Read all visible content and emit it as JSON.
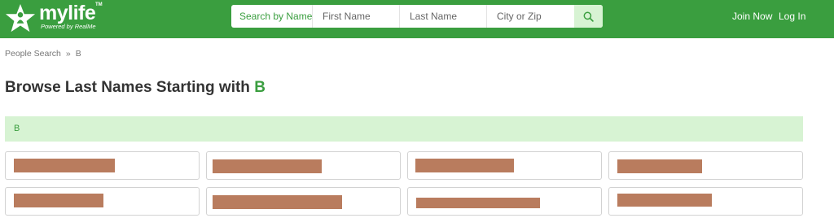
{
  "brand": {
    "name": "mylife",
    "trademark": "TM",
    "tagline": "Powered by RealMe",
    "color": "#3a9e3f"
  },
  "search": {
    "mode_label": "Search by Name",
    "first_placeholder": "First Name",
    "last_placeholder": "Last Name",
    "city_placeholder": "City or Zip",
    "button_icon": "search-icon"
  },
  "nav": {
    "join": "Join Now",
    "login": "Log In"
  },
  "breadcrumb": {
    "root": "People Search",
    "separator": "»",
    "current": "B"
  },
  "page": {
    "title_prefix": "Browse Last Names Starting with ",
    "title_letter": "B"
  },
  "letter_section": {
    "letter": "B",
    "background": "#d7f3d3"
  },
  "name_cards": {
    "count": 8,
    "redacted": true,
    "redaction_color": "#b97c5e"
  }
}
